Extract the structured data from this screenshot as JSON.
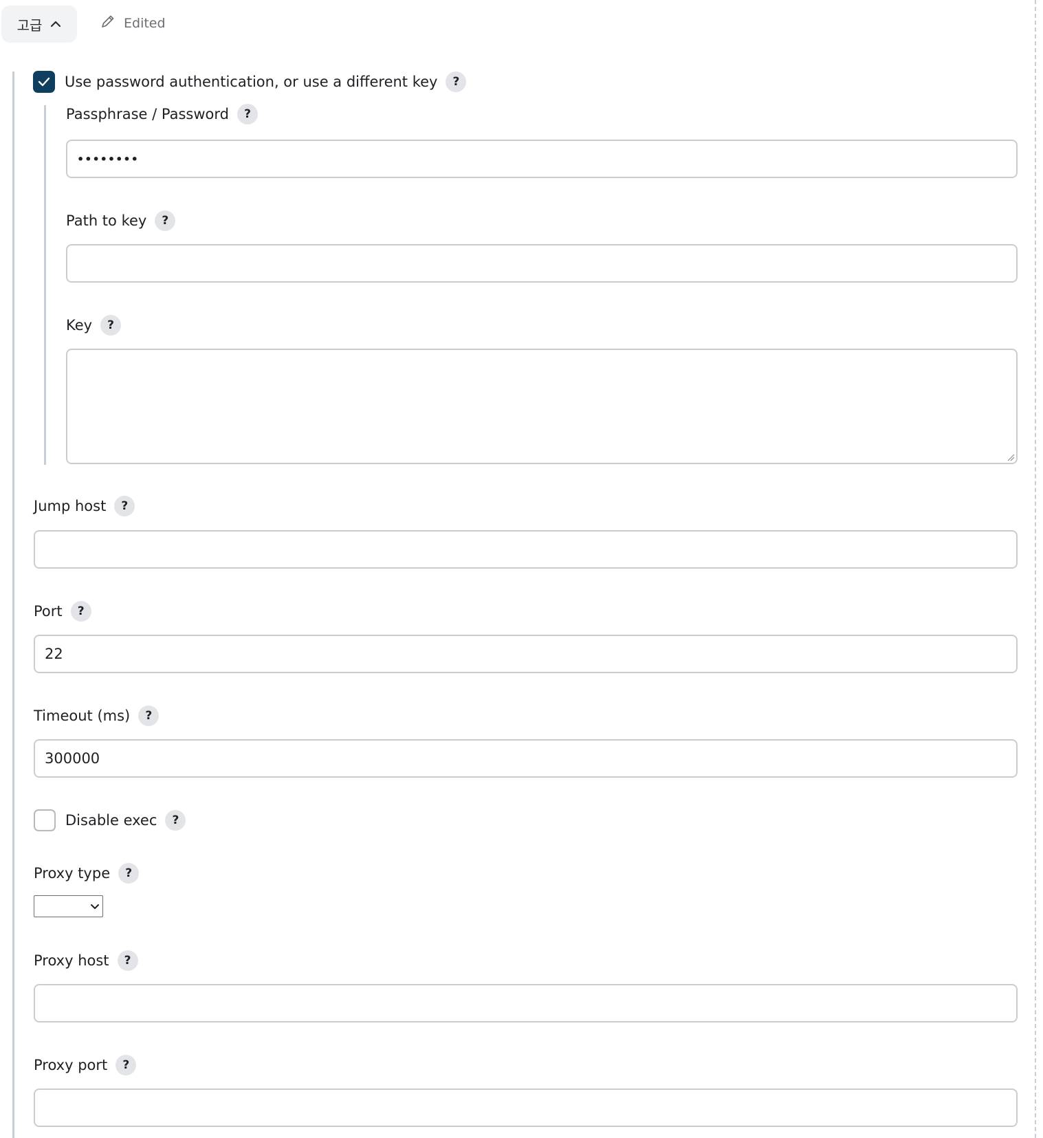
{
  "header": {
    "advanced_label": "고급",
    "edited_label": "Edited"
  },
  "auth": {
    "use_password_label": "Use password authentication, or use a different key",
    "use_password_checked": true,
    "passphrase_label": "Passphrase / Password",
    "passphrase_value": "••••••••",
    "path_to_key_label": "Path to key",
    "path_to_key_value": "",
    "key_label": "Key",
    "key_value": ""
  },
  "jump_host": {
    "label": "Jump host",
    "value": ""
  },
  "port": {
    "label": "Port",
    "value": "22"
  },
  "timeout": {
    "label": "Timeout (ms)",
    "value": "300000"
  },
  "disable_exec": {
    "label": "Disable exec",
    "checked": false
  },
  "proxy_type": {
    "label": "Proxy type",
    "selected": ""
  },
  "proxy_host": {
    "label": "Proxy host",
    "value": ""
  },
  "proxy_port": {
    "label": "Proxy port",
    "value": ""
  },
  "help_glyph": "?",
  "icons": {
    "chevron": "chevron-up-icon",
    "edited": "pencil-icon",
    "check": "check-icon",
    "help": "help-icon",
    "select": "chevron-down-icon"
  },
  "colors": {
    "checkbox_checked": "#0e3f5e",
    "help_bg": "#e3e4e7",
    "border": "#c9cdd2",
    "rail": "#c8ced6"
  }
}
